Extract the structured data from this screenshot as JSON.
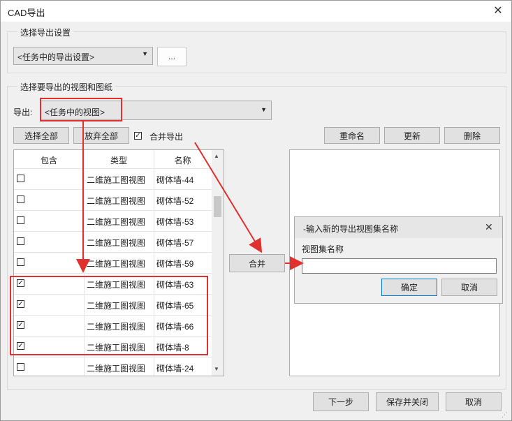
{
  "window": {
    "title": "CAD导出",
    "close_glyph": "✕"
  },
  "settings_group": {
    "legend": "选择导出设置",
    "combo_value": "<任务中的导出设置>",
    "browse_label": "..."
  },
  "views_group": {
    "legend": "选择要导出的视图和图纸",
    "export_label": "导出:",
    "export_combo_value": "<任务中的视图>",
    "select_all": "选择全部",
    "deselect_all": "放弃全部",
    "merge_export_label": "合并导出",
    "merge_export_checked": true,
    "rename": "重命名",
    "update": "更新",
    "delete": "删除",
    "merge_button": "合并"
  },
  "table": {
    "headers": [
      "包含",
      "类型",
      "名称"
    ],
    "rows": [
      {
        "checked": false,
        "type": "二维施工图视图",
        "name": "砌体墙-44"
      },
      {
        "checked": false,
        "type": "二维施工图视图",
        "name": "砌体墙-52"
      },
      {
        "checked": false,
        "type": "二维施工图视图",
        "name": "砌体墙-53"
      },
      {
        "checked": false,
        "type": "二维施工图视图",
        "name": "砌体墙-57"
      },
      {
        "checked": false,
        "type": "二维施工图视图",
        "name": "砌体墙-59"
      },
      {
        "checked": true,
        "type": "二维施工图视图",
        "name": "砌体墙-63"
      },
      {
        "checked": true,
        "type": "二维施工图视图",
        "name": "砌体墙-65"
      },
      {
        "checked": true,
        "type": "二维施工图视图",
        "name": "砌体墙-66"
      },
      {
        "checked": true,
        "type": "二维施工图视图",
        "name": "砌体墙-8"
      },
      {
        "checked": false,
        "type": "二维施工图视图",
        "name": "砌体墙-24"
      }
    ]
  },
  "popup": {
    "title": "-输入新的导出视图集名称",
    "field_label": "视图集名称",
    "field_value": "",
    "ok": "确定",
    "cancel": "取消"
  },
  "footer": {
    "next": "下一步",
    "save_close": "保存并关闭",
    "cancel": "取消"
  },
  "colors": {
    "annotation": "#e03030"
  }
}
